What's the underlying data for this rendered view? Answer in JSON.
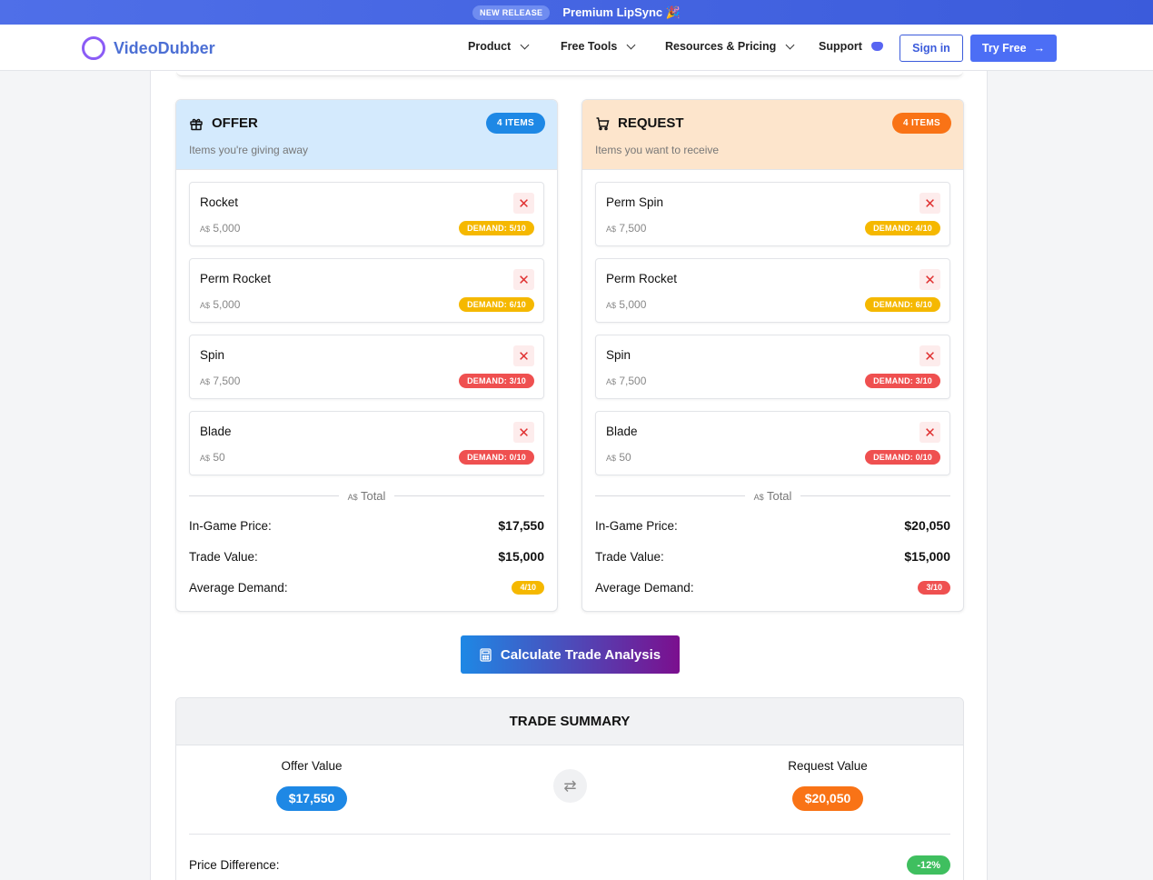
{
  "promo": {
    "badge": "NEW RELEASE",
    "title": "Premium LipSync 🎉"
  },
  "header": {
    "logo": "VideoDubber",
    "nav": [
      {
        "label": "Product"
      },
      {
        "label": "Free Tools"
      },
      {
        "label": "Resources & Pricing"
      },
      {
        "label": "Support"
      }
    ],
    "signin": "Sign in",
    "try_free": "Try Free",
    "try_arrow": "→"
  },
  "offer": {
    "title": "OFFER",
    "subtitle": "Items you're giving away",
    "count": "4 ITEMS",
    "items": [
      {
        "name": "Rocket",
        "currency": "A$",
        "price": "5,000",
        "demand": "DEMAND: 5/10"
      },
      {
        "name": "Perm Rocket",
        "currency": "A$",
        "price": "5,000",
        "demand": "DEMAND: 6/10"
      },
      {
        "name": "Spin",
        "currency": "A$",
        "price": "7,500",
        "demand": "DEMAND: 3/10"
      },
      {
        "name": "Blade",
        "currency": "A$",
        "price": "50",
        "demand": "DEMAND: 0/10"
      }
    ],
    "total_currency": "A$",
    "total_label": "Total",
    "ingame_label": "In-Game Price:",
    "ingame_value": "$17,550",
    "trade_label": "Trade Value:",
    "trade_value": "$15,000",
    "avg_label": "Average Demand:",
    "avg_value": "4/10"
  },
  "request": {
    "title": "REQUEST",
    "subtitle": "Items you want to receive",
    "count": "4 ITEMS",
    "items": [
      {
        "name": "Perm Spin",
        "currency": "A$",
        "price": "7,500",
        "demand": "DEMAND: 4/10"
      },
      {
        "name": "Perm Rocket",
        "currency": "A$",
        "price": "5,000",
        "demand": "DEMAND: 6/10"
      },
      {
        "name": "Spin",
        "currency": "A$",
        "price": "7,500",
        "demand": "DEMAND: 3/10"
      },
      {
        "name": "Blade",
        "currency": "A$",
        "price": "50",
        "demand": "DEMAND: 0/10"
      }
    ],
    "total_currency": "A$",
    "total_label": "Total",
    "ingame_label": "In-Game Price:",
    "ingame_value": "$20,050",
    "trade_label": "Trade Value:",
    "trade_value": "$15,000",
    "avg_label": "Average Demand:",
    "avg_value": "3/10"
  },
  "remove_glyph": "✕",
  "calculate_button": "Calculate Trade Analysis",
  "summary": {
    "title": "TRADE SUMMARY",
    "offer_label": "Offer Value",
    "offer_value": "$17,550",
    "request_label": "Request Value",
    "request_value": "$20,050",
    "swap_glyph": "⇄",
    "price_diff_label": "Price Difference:",
    "price_diff_value": "-12%"
  },
  "colors": {
    "offer_accent": "#1e88e5",
    "request_accent": "#f97316",
    "demand_mid": "#f5b800",
    "demand_low": "#ef5050",
    "positive": "#3fbf5f"
  }
}
